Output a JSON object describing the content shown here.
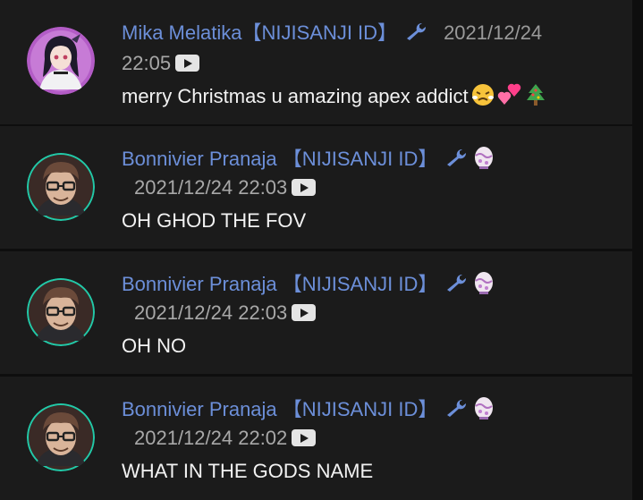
{
  "messages": [
    {
      "author": "Mika Melatika【NIJISANJI ID】",
      "date": "2021/12/24",
      "time": "22:05",
      "text": "merry Christmas u amazing apex addict",
      "badges": [
        "wrench-icon"
      ],
      "emojis": [
        "tired-face-emoji",
        "two-hearts-emoji",
        "christmas-tree-emoji"
      ],
      "avatar": "mika-avatar"
    },
    {
      "author": "Bonnivier Pranaja 【NIJISANJI ID】",
      "timestamp": "2021/12/24 22:03",
      "text": "OH GHOD THE FOV",
      "badges": [
        "wrench-icon",
        "egg-icon"
      ],
      "avatar": "bonnivier-avatar"
    },
    {
      "author": "Bonnivier Pranaja 【NIJISANJI ID】",
      "timestamp": "2021/12/24 22:03",
      "text": "OH NO",
      "badges": [
        "wrench-icon",
        "egg-icon"
      ],
      "avatar": "bonnivier-avatar"
    },
    {
      "author": "Bonnivier Pranaja 【NIJISANJI ID】",
      "timestamp": "2021/12/24 22:02",
      "text": "WHAT IN THE GODS NAME",
      "badges": [
        "wrench-icon",
        "egg-icon"
      ],
      "avatar": "bonnivier-avatar"
    }
  ],
  "colors": {
    "background": "#1b1b1b",
    "separator": "#0e0e0e",
    "author": "#6c8fd9",
    "timestamp": "#a8a8a8",
    "text": "#f2f2f2"
  }
}
